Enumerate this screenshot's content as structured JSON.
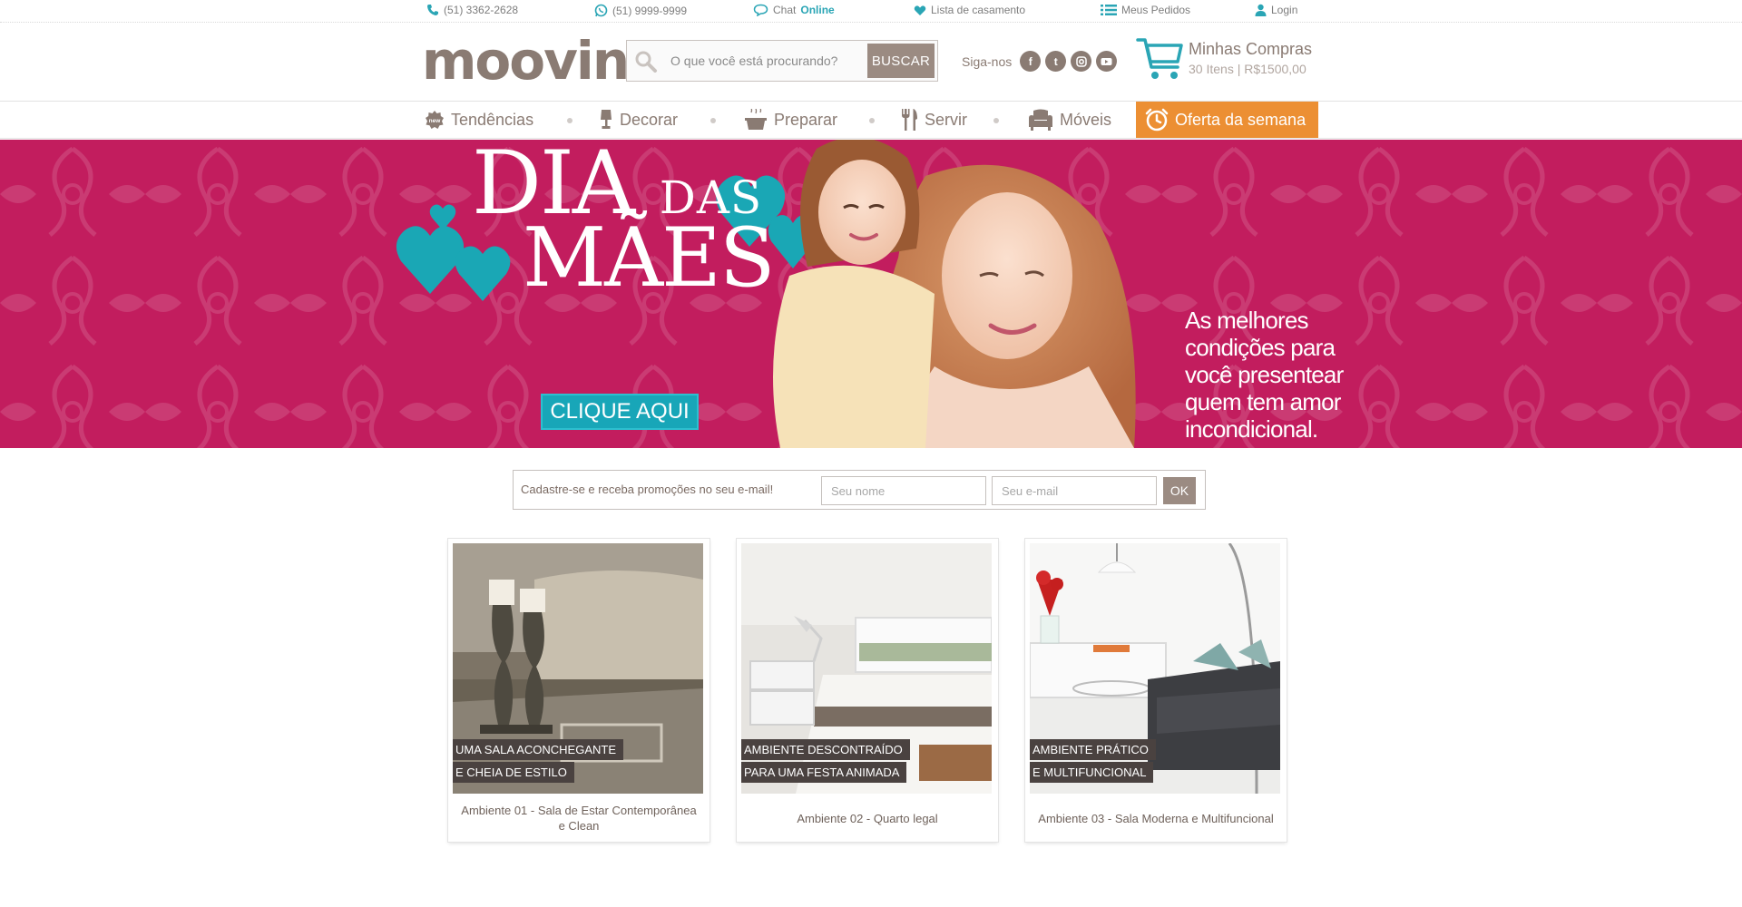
{
  "topbar": {
    "phone": "(51) 3362-2628",
    "whatsapp": "(51) 9999-9999",
    "chat_label": "Chat",
    "chat_status": "Online",
    "wedding_list": "Lista de casamento",
    "orders": "Meus Pedidos",
    "login": "Login"
  },
  "header": {
    "logo": "moovin",
    "search_placeholder": "O que você está procurando?",
    "search_button": "BUSCAR",
    "social_label": "Siga-nos",
    "social_icons": [
      "facebook-icon",
      "twitter-icon",
      "instagram-icon",
      "youtube-icon"
    ],
    "cart_title": "Minhas Compras",
    "cart_items": "30 Itens",
    "cart_separator": "|",
    "cart_total": "R$1500,00"
  },
  "nav": {
    "items": [
      {
        "label": "Tendências",
        "icon": "new-badge-icon"
      },
      {
        "label": "Decorar",
        "icon": "lamp-icon"
      },
      {
        "label": "Preparar",
        "icon": "pot-icon"
      },
      {
        "label": "Servir",
        "icon": "cutlery-icon"
      },
      {
        "label": "Móveis",
        "icon": "armchair-icon"
      },
      {
        "label": "Oferta da semana",
        "icon": "clock-icon"
      }
    ]
  },
  "banner": {
    "title_line1_big": "DIA",
    "title_line1_small": "DAS",
    "title_line2": "MÃES",
    "cta": "CLIQUE AQUI",
    "tagline": "As melhores condições para você presentear quem tem amor incondicional."
  },
  "newsletter": {
    "text": "Cadastre-se e receba promoções no seu e-mail!",
    "name_placeholder": "Seu nome",
    "email_placeholder": "Seu e-mail",
    "button": "OK"
  },
  "cards": [
    {
      "tag1": "UMA SALA ACONCHEGANTE",
      "tag2": "E CHEIA DE ESTILO",
      "caption": "Ambiente 01 - Sala de Estar Contemporânea e Clean"
    },
    {
      "tag1": "AMBIENTE DESCONTRAÍDO",
      "tag2": "PARA UMA FESTA ANIMADA",
      "caption": "Ambiente 02 - Quarto legal"
    },
    {
      "tag1": "AMBIENTE PRÁTICO",
      "tag2": "E MULTIFUNCIONAL",
      "caption": "Ambiente 03 - Sala Moderna e Multifuncional"
    }
  ],
  "colors": {
    "brand": "#8a7b73",
    "banner_bg": "#c21d5e",
    "accent_teal": "#18a6b8",
    "offer_orange": "#ec8f33"
  }
}
